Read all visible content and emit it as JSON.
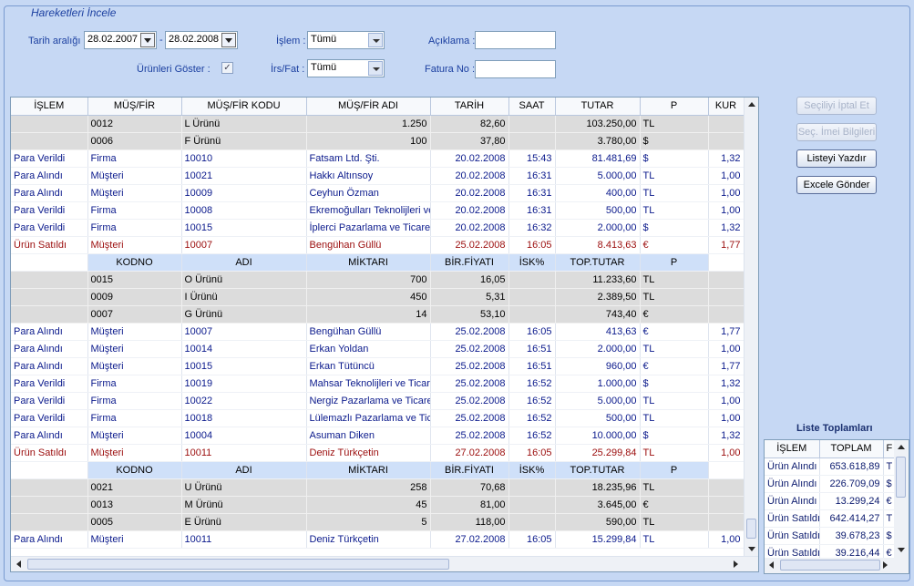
{
  "window": {
    "group_title": "Hareketleri İncele"
  },
  "filters": {
    "date_range_label": "Tarih aralığı :",
    "date_from": "28.02.2007",
    "date_sep": "-",
    "date_to": "28.02.2008",
    "islem_label": "İşlem :",
    "islem_value": "Tümü",
    "aciklama_label": "Açıklama :",
    "aciklama_value": "",
    "urunleri_goster_label": "Ürünleri Göster :",
    "urunleri_goster_checked": "✓",
    "irs_fat_label": "İrs/Fat :",
    "irs_fat_value": "Tümü",
    "fatura_no_label": "Fatura No :",
    "fatura_no_value": ""
  },
  "buttons": {
    "cancel_selected": "Seçiliyi İptal Et",
    "imei_info": "Seç. İmei Bilgileri",
    "print_list": "Listeyi Yazdır",
    "send_excel": "Excele Gönder"
  },
  "grid": {
    "columns": [
      "İŞLEM",
      "MÜŞ/FİR",
      "MÜŞ/FİR KODU",
      "MÜŞ/FİR ADI",
      "TARİH",
      "SAAT",
      "TUTAR",
      "P",
      "KUR"
    ],
    "sub_columns": [
      "KODNO",
      "ADI",
      "MİKTARI",
      "BİR.FİYATI",
      "İSK%",
      "TOP.TUTAR",
      "P"
    ],
    "rows": [
      {
        "type": "sub",
        "kod": "0012",
        "adi": "L Ürünü",
        "miktar": "1.250",
        "fiyat": "82,60",
        "isk": "",
        "tutar": "103.250,00",
        "p": "TL"
      },
      {
        "type": "sub",
        "kod": "0006",
        "adi": "F Ürünü",
        "miktar": "100",
        "fiyat": "37,80",
        "isk": "",
        "tutar": "3.780,00",
        "p": "$"
      },
      {
        "type": "main",
        "islem": "Para Verildi",
        "musfir": "Firma",
        "kodu": "10010",
        "adi": "Fatsam Ltd. Şti.",
        "tarih": "20.02.2008",
        "saat": "15:43",
        "tutar": "81.481,69",
        "p": "$",
        "kur": "1,32"
      },
      {
        "type": "main",
        "islem": "Para Alındı",
        "musfir": "Müşteri",
        "kodu": "10021",
        "adi": "Hakkı Altınsoy",
        "tarih": "20.02.2008",
        "saat": "16:31",
        "tutar": "5.000,00",
        "p": "TL",
        "kur": "1,00"
      },
      {
        "type": "main",
        "islem": "Para Alındı",
        "musfir": "Müşteri",
        "kodu": "10009",
        "adi": "Ceyhun Özman",
        "tarih": "20.02.2008",
        "saat": "16:31",
        "tutar": "400,00",
        "p": "TL",
        "kur": "1,00"
      },
      {
        "type": "main",
        "islem": "Para Verildi",
        "musfir": "Firma",
        "kodu": "10008",
        "adi": "Ekremoğulları Teknolijleri ve",
        "tarih": "20.02.2008",
        "saat": "16:31",
        "tutar": "500,00",
        "p": "TL",
        "kur": "1,00"
      },
      {
        "type": "main",
        "islem": "Para Verildi",
        "musfir": "Firma",
        "kodu": "10015",
        "adi": "İplerci Pazarlama ve Ticaret",
        "tarih": "20.02.2008",
        "saat": "16:32",
        "tutar": "2.000,00",
        "p": "$",
        "kur": "1,32"
      },
      {
        "type": "sale",
        "islem": "Ürün Satıldı",
        "musfir": "Müşteri",
        "kodu": "10007",
        "adi": "Bengühan Güllü",
        "tarih": "25.02.2008",
        "saat": "16:05",
        "tutar": "8.413,63",
        "p": "€",
        "kur": "1,77"
      },
      {
        "type": "subhdr"
      },
      {
        "type": "sub",
        "kod": "0015",
        "adi": "O Ürünü",
        "miktar": "700",
        "fiyat": "16,05",
        "isk": "",
        "tutar": "11.233,60",
        "p": "TL"
      },
      {
        "type": "sub",
        "kod": "0009",
        "adi": "I Ürünü",
        "miktar": "450",
        "fiyat": "5,31",
        "isk": "",
        "tutar": "2.389,50",
        "p": "TL"
      },
      {
        "type": "sub",
        "kod": "0007",
        "adi": "G Ürünü",
        "miktar": "14",
        "fiyat": "53,10",
        "isk": "",
        "tutar": "743,40",
        "p": "€"
      },
      {
        "type": "main",
        "islem": "Para Alındı",
        "musfir": "Müşteri",
        "kodu": "10007",
        "adi": "Bengühan Güllü",
        "tarih": "25.02.2008",
        "saat": "16:05",
        "tutar": "413,63",
        "p": "€",
        "kur": "1,77"
      },
      {
        "type": "main",
        "islem": "Para Alındı",
        "musfir": "Müşteri",
        "kodu": "10014",
        "adi": "Erkan Yoldan",
        "tarih": "25.02.2008",
        "saat": "16:51",
        "tutar": "2.000,00",
        "p": "TL",
        "kur": "1,00"
      },
      {
        "type": "main",
        "islem": "Para Alındı",
        "musfir": "Müşteri",
        "kodu": "10015",
        "adi": "Erkan Tütüncü",
        "tarih": "25.02.2008",
        "saat": "16:51",
        "tutar": "960,00",
        "p": "€",
        "kur": "1,77"
      },
      {
        "type": "main",
        "islem": "Para Verildi",
        "musfir": "Firma",
        "kodu": "10019",
        "adi": "Mahsar Teknolijleri ve Ticar",
        "tarih": "25.02.2008",
        "saat": "16:52",
        "tutar": "1.000,00",
        "p": "$",
        "kur": "1,32"
      },
      {
        "type": "main",
        "islem": "Para Verildi",
        "musfir": "Firma",
        "kodu": "10022",
        "adi": "Nergiz Pazarlama ve Ticare",
        "tarih": "25.02.2008",
        "saat": "16:52",
        "tutar": "5.000,00",
        "p": "TL",
        "kur": "1,00"
      },
      {
        "type": "main",
        "islem": "Para Verildi",
        "musfir": "Firma",
        "kodu": "10018",
        "adi": "Lülemazlı Pazarlama ve Tica",
        "tarih": "25.02.2008",
        "saat": "16:52",
        "tutar": "500,00",
        "p": "TL",
        "kur": "1,00"
      },
      {
        "type": "main",
        "islem": "Para Alındı",
        "musfir": "Müşteri",
        "kodu": "10004",
        "adi": "Asuman Diken",
        "tarih": "25.02.2008",
        "saat": "16:52",
        "tutar": "10.000,00",
        "p": "$",
        "kur": "1,32"
      },
      {
        "type": "sale",
        "islem": "Ürün Satıldı",
        "musfir": "Müşteri",
        "kodu": "10011",
        "adi": "Deniz Türkçetin",
        "tarih": "27.02.2008",
        "saat": "16:05",
        "tutar": "25.299,84",
        "p": "TL",
        "kur": "1,00"
      },
      {
        "type": "subhdr"
      },
      {
        "type": "sub",
        "kod": "0021",
        "adi": "U Ürünü",
        "miktar": "258",
        "fiyat": "70,68",
        "isk": "",
        "tutar": "18.235,96",
        "p": "TL"
      },
      {
        "type": "sub",
        "kod": "0013",
        "adi": "M Ürünü",
        "miktar": "45",
        "fiyat": "81,00",
        "isk": "",
        "tutar": "3.645,00",
        "p": "€"
      },
      {
        "type": "sub",
        "kod": "0005",
        "adi": "E Ürünü",
        "miktar": "5",
        "fiyat": "118,00",
        "isk": "",
        "tutar": "590,00",
        "p": "TL"
      },
      {
        "type": "main",
        "islem": "Para Alındı",
        "musfir": "Müşteri",
        "kodu": "10011",
        "adi": "Deniz Türkçetin",
        "tarih": "27.02.2008",
        "saat": "16:05",
        "tutar": "15.299,84",
        "p": "TL",
        "kur": "1,00"
      }
    ]
  },
  "totals": {
    "title": "Liste Toplamları",
    "columns": [
      "İŞLEM",
      "TOPLAM",
      "F"
    ],
    "rows": [
      {
        "islem": "Ürün Alındı",
        "toplam": "653.618,89",
        "p": "T"
      },
      {
        "islem": "Ürün Alındı",
        "toplam": "226.709,09",
        "p": "$"
      },
      {
        "islem": "Ürün Alındı",
        "toplam": "13.299,24",
        "p": "€"
      },
      {
        "islem": "Ürün Satıldı",
        "toplam": "642.414,27",
        "p": "T"
      },
      {
        "islem": "Ürün Satıldı",
        "toplam": "39.678,23",
        "p": "$"
      },
      {
        "islem": "Ürün Satıldı",
        "toplam": "39.216,44",
        "p": "€"
      }
    ]
  }
}
